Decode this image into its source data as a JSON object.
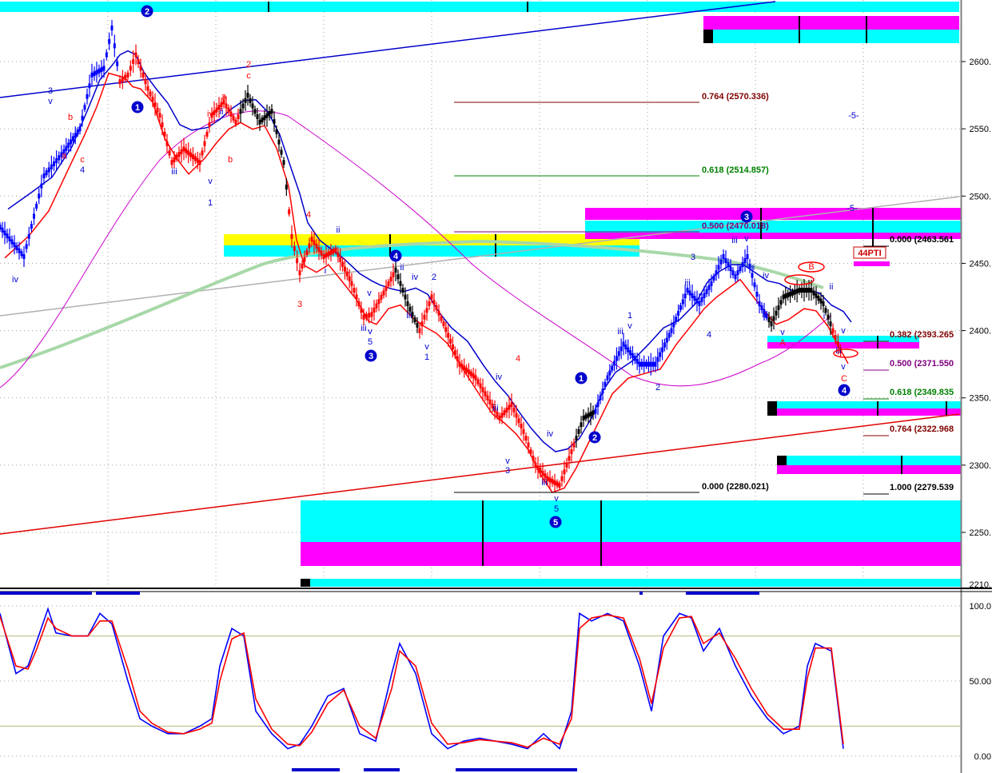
{
  "chart_data": [
    {
      "type": "line",
      "title": "",
      "xlabel": "",
      "ylabel": "",
      "ylim": [
        2210,
        2620
      ],
      "grid": true,
      "y_ticks": [
        2250,
        2300,
        2350,
        2400,
        2450,
        2500,
        2550,
        2600
      ],
      "y_tick_labels": [
        "2250.",
        "2300.",
        "2350.",
        "2400.",
        "2450.",
        "2500.",
        "2550.",
        "2600."
      ],
      "bottom_tick_label": "2210.",
      "price_series": {
        "name": "",
        "x": [
          0,
          30,
          55,
          80,
          100,
          115,
          130,
          140,
          150,
          160,
          170,
          185,
          200,
          215,
          230,
          250,
          265,
          280,
          295,
          310,
          325,
          340,
          355,
          365,
          375,
          390,
          405,
          420,
          440,
          455,
          465,
          480,
          495,
          510,
          525,
          540,
          555,
          575,
          595,
          610,
          625,
          640,
          655,
          670,
          685,
          700,
          715,
          730,
          745,
          760,
          780,
          800,
          820,
          840,
          860,
          875,
          890,
          905,
          920,
          935,
          950,
          965,
          980,
          1000,
          1015,
          1030,
          1045,
          1055
        ],
        "values": [
          2477,
          2455,
          2515,
          2533,
          2550,
          2590,
          2595,
          2625,
          2585,
          2590,
          2605,
          2580,
          2560,
          2525,
          2535,
          2525,
          2560,
          2570,
          2555,
          2575,
          2555,
          2563,
          2525,
          2470,
          2443,
          2468,
          2455,
          2460,
          2435,
          2410,
          2412,
          2428,
          2445,
          2420,
          2400,
          2425,
          2405,
          2375,
          2365,
          2350,
          2335,
          2345,
          2325,
          2300,
          2290,
          2285,
          2310,
          2335,
          2340,
          2365,
          2390,
          2375,
          2375,
          2400,
          2430,
          2420,
          2435,
          2455,
          2440,
          2455,
          2420,
          2405,
          2425,
          2430,
          2430,
          2420,
          2395,
          2380
        ],
        "colors_by_segment": [
          "#0000ff",
          "#ff0000",
          "#000000"
        ]
      },
      "moving_averages": [
        {
          "name": "",
          "color": "#ff0000"
        },
        {
          "name": "",
          "color": "#0000cc"
        },
        {
          "name": "",
          "color": "#cc00cc"
        },
        {
          "name": "",
          "color": "#a8d8a8"
        }
      ],
      "fib_levels_upper": [
        {
          "ratio": "0.764",
          "value": "(2570.336)",
          "label": "0.764 (2570.336)",
          "color": "#800000"
        },
        {
          "ratio": "0.618",
          "value": "(2514.857)",
          "label": "0.618 (2514.857)",
          "color": "#008000"
        },
        {
          "ratio": "0.500",
          "value": "(2470.018)",
          "label": "0.500 (2470.018)",
          "color": "#800080"
        },
        {
          "ratio": "0.000",
          "value": "(2280.021)",
          "label": "0.000 (2280.021)",
          "color": "#000000"
        }
      ],
      "fib_levels_right": [
        {
          "label": "0.000 (2463.561",
          "color": "#000000"
        },
        {
          "label": "0.382 (2393.265",
          "color": "#800000"
        },
        {
          "label": "0.500 (2371.550",
          "color": "#800080"
        },
        {
          "label": "0.618 (2349.835",
          "color": "#008000"
        },
        {
          "label": "0.764 (2322.968",
          "color": "#800000"
        },
        {
          "label": "1.000 (2279.539",
          "color": "#000000"
        }
      ],
      "wave_labels_circled": [
        "1",
        "2",
        "3",
        "4",
        "5"
      ],
      "wave_labels": {
        "roman": [
          "i",
          "ii",
          "iii",
          "iv",
          "v"
        ],
        "abc": [
          "a",
          "b",
          "c",
          "A",
          "B",
          "C"
        ],
        "numeric": [
          "1",
          "2",
          "3",
          "4",
          "5"
        ],
        "misc": [
          "-5-",
          "44PTI"
        ]
      }
    },
    {
      "type": "line",
      "title": "",
      "ylim": [
        0,
        105
      ],
      "y_ticks": [
        0,
        50,
        100
      ],
      "y_tick_labels": [
        "0.00",
        "50.00",
        "100.0"
      ],
      "guide_levels": [
        20,
        80
      ],
      "series": [
        {
          "name": "",
          "color": "#0000ff",
          "x": [
            0,
            20,
            35,
            45,
            60,
            70,
            90,
            110,
            125,
            140,
            160,
            175,
            190,
            210,
            230,
            250,
            265,
            275,
            290,
            305,
            320,
            340,
            360,
            375,
            390,
            410,
            430,
            450,
            470,
            490,
            500,
            520,
            540,
            560,
            580,
            600,
            620,
            640,
            660,
            680,
            700,
            715,
            725,
            740,
            760,
            780,
            800,
            815,
            830,
            850,
            865,
            880,
            900,
            920,
            940,
            960,
            980,
            1000,
            1010,
            1020,
            1040,
            1055
          ],
          "values": [
            95,
            55,
            60,
            75,
            98,
            82,
            80,
            80,
            95,
            88,
            50,
            25,
            20,
            15,
            15,
            20,
            25,
            60,
            85,
            80,
            30,
            15,
            5,
            8,
            20,
            40,
            45,
            15,
            10,
            55,
            75,
            55,
            15,
            5,
            10,
            12,
            10,
            8,
            5,
            15,
            5,
            30,
            95,
            90,
            95,
            90,
            60,
            30,
            80,
            95,
            92,
            70,
            85,
            60,
            40,
            25,
            15,
            20,
            60,
            75,
            70,
            5
          ]
        },
        {
          "name": "",
          "color": "#ff0000",
          "x": [
            0,
            20,
            35,
            45,
            60,
            70,
            90,
            110,
            125,
            140,
            160,
            175,
            190,
            210,
            230,
            250,
            265,
            275,
            290,
            305,
            320,
            340,
            360,
            375,
            390,
            410,
            430,
            450,
            470,
            490,
            500,
            520,
            540,
            560,
            580,
            600,
            620,
            640,
            660,
            680,
            700,
            715,
            725,
            740,
            760,
            780,
            800,
            815,
            830,
            850,
            865,
            880,
            900,
            920,
            940,
            960,
            980,
            1000,
            1010,
            1020,
            1040,
            1055
          ],
          "values": [
            93,
            60,
            58,
            70,
            92,
            85,
            80,
            80,
            90,
            90,
            58,
            30,
            22,
            16,
            15,
            18,
            22,
            50,
            78,
            82,
            38,
            18,
            8,
            7,
            16,
            35,
            44,
            20,
            12,
            45,
            70,
            60,
            22,
            8,
            9,
            11,
            10,
            9,
            6,
            12,
            8,
            25,
            85,
            92,
            94,
            92,
            65,
            35,
            72,
            92,
            93,
            75,
            82,
            65,
            45,
            28,
            18,
            18,
            52,
            72,
            72,
            8
          ]
        }
      ]
    }
  ],
  "colors": {
    "cyan": "#00ffff",
    "magenta": "#ff00ff",
    "yellow": "#ffff00",
    "trend_blue": "#0000cc",
    "trend_red": "#e00000",
    "trend_gray": "#b0b0b0",
    "grid": "#a0a0a0"
  }
}
